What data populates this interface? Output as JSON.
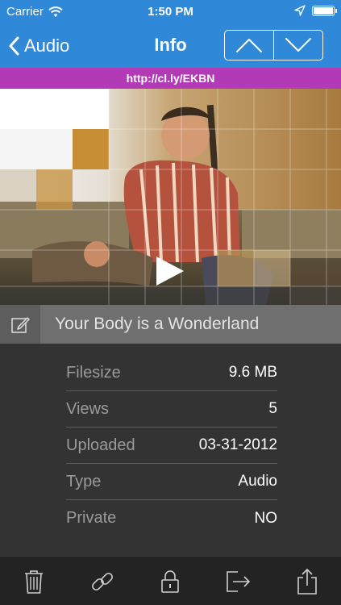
{
  "status_bar": {
    "carrier": "Carrier",
    "time": "1:50 PM"
  },
  "nav": {
    "back_label": "Audio",
    "title": "Info"
  },
  "url": "http://cl.ly/EKBN",
  "media": {
    "title": "Your Body is a Wonderland"
  },
  "info": {
    "rows": [
      {
        "label": "Filesize",
        "value": "9.6 MB"
      },
      {
        "label": "Views",
        "value": "5"
      },
      {
        "label": "Uploaded",
        "value": "03-31-2012"
      },
      {
        "label": "Type",
        "value": "Audio"
      },
      {
        "label": "Private",
        "value": "NO"
      }
    ]
  },
  "toolbar": {
    "icons": [
      "trash-icon",
      "link-icon",
      "lock-icon",
      "sign-out-icon",
      "share-icon"
    ]
  },
  "colors": {
    "nav_blue": "#2f89d8",
    "url_purple": "#b23ab6",
    "background": "#333333",
    "toolbar": "#232323"
  }
}
